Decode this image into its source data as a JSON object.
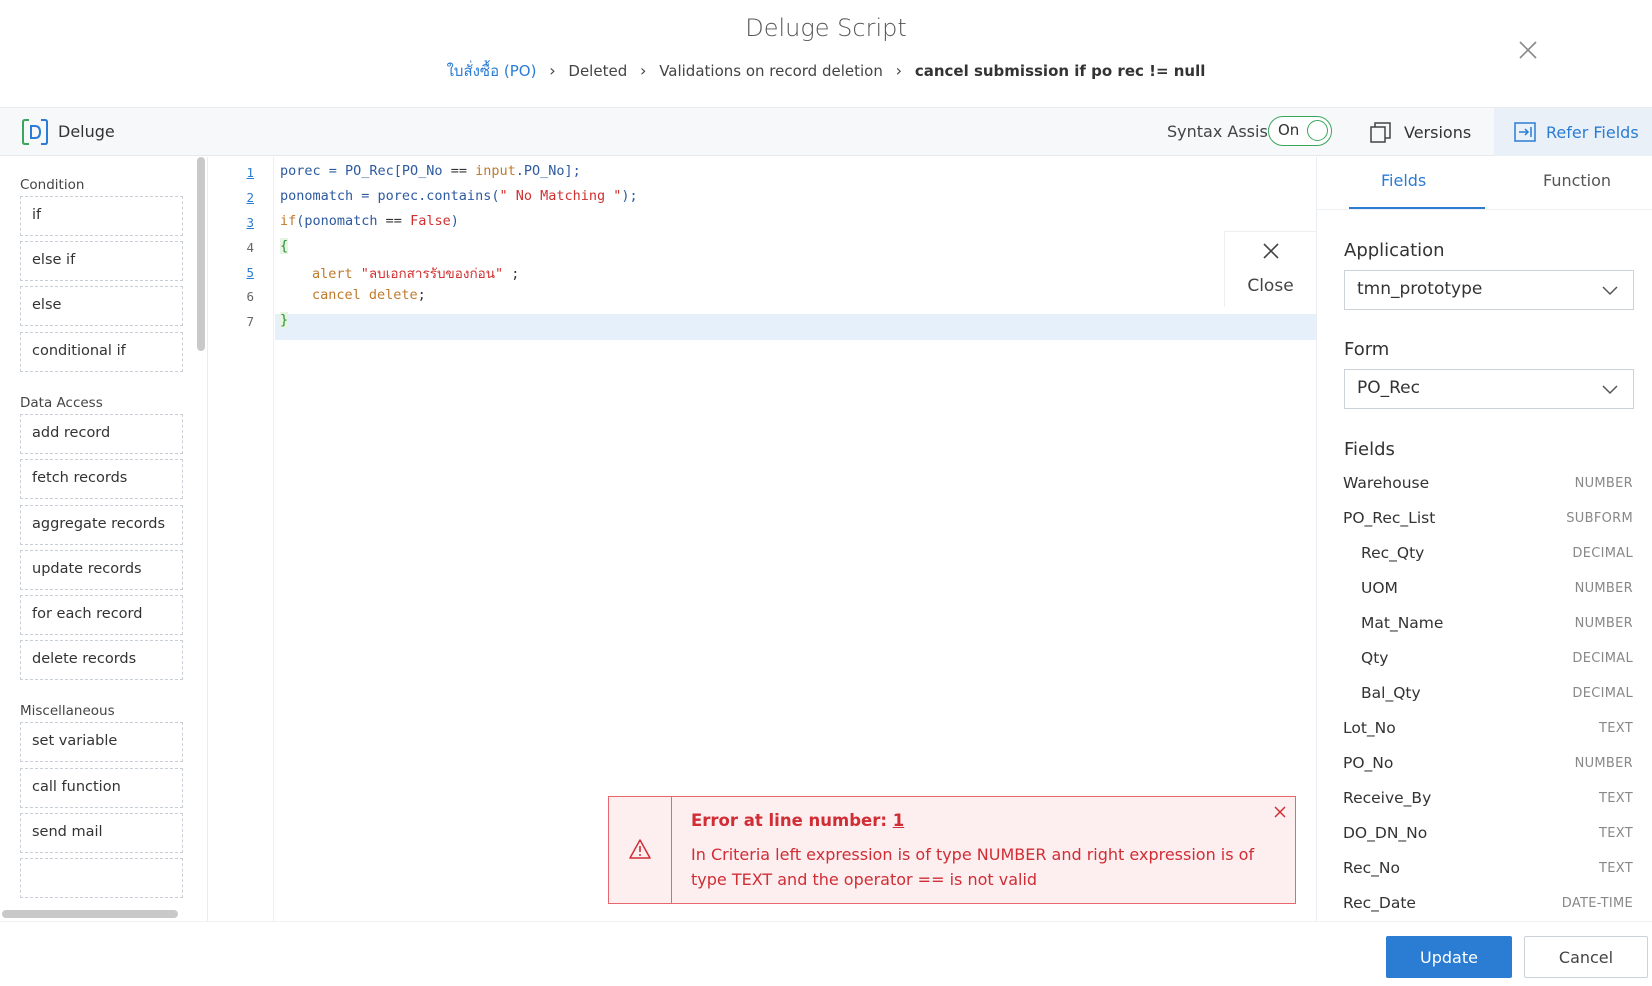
{
  "header": {
    "title": "Deluge Script",
    "breadcrumb": [
      "ใบสั่งซื้อ (PO)",
      "Deleted",
      "Validations on record deletion",
      "cancel submission if po rec != null"
    ]
  },
  "toolbar": {
    "brand": "Deluge",
    "syntax_assist_label": "Syntax Assist",
    "syntax_assist_state": "On",
    "versions_label": "Versions",
    "refer_fields_label": "Refer Fields"
  },
  "palette": {
    "sections": [
      {
        "title": "Condition",
        "items": [
          "if",
          "else if",
          "else",
          "conditional if"
        ]
      },
      {
        "title": "Data Access",
        "items": [
          "add record",
          "fetch records",
          "aggregate records",
          "update records",
          "for each record",
          "delete records"
        ]
      },
      {
        "title": "Miscellaneous",
        "items": [
          "set variable",
          "call function",
          "send mail"
        ]
      }
    ]
  },
  "editor": {
    "line_numbers": [
      "1",
      "2",
      "3",
      "4",
      "5",
      "6",
      "7"
    ],
    "code": {
      "l1": {
        "a": "porec = PO_Rec[PO_No ",
        "b": "==",
        "c": " ",
        "d": "input",
        "e": ".PO_No];"
      },
      "l2": {
        "a": "ponomatch = porec.contains(",
        "b": "\" No Matching \"",
        "c": ");"
      },
      "l3": {
        "a": "if",
        "b": "(ponomatch ",
        "c": "==",
        "d": " ",
        "e": "False",
        "f": ")"
      },
      "l4": {
        "a": "{"
      },
      "l5": {
        "a": "alert",
        "b": " ",
        "c": "\"ลบเอกสารรับของก่อน\"",
        "d": " ;"
      },
      "l6": {
        "a": "cancel delete",
        "b": ";"
      },
      "l7": {
        "a": "}"
      }
    },
    "close_label": "Close"
  },
  "error": {
    "title_prefix": "Error at line number: ",
    "line": "1",
    "message": "In Criteria left expression is of type NUMBER and right expression is of type TEXT and the operator == is not valid"
  },
  "refer_panel": {
    "tabs": [
      "Fields",
      "Function"
    ],
    "application_label": "Application",
    "application_value": "tmn_prototype",
    "form_label": "Form",
    "form_value": "PO_Rec",
    "fields_label": "Fields",
    "fields": [
      {
        "name": "Warehouse",
        "type": "NUMBER"
      },
      {
        "name": "PO_Rec_List",
        "type": "SUBFORM"
      },
      {
        "name": "Rec_Qty",
        "type": "DECIMAL"
      },
      {
        "name": "UOM",
        "type": "NUMBER"
      },
      {
        "name": "Mat_Name",
        "type": "NUMBER"
      },
      {
        "name": "Qty",
        "type": "DECIMAL"
      },
      {
        "name": "Bal_Qty",
        "type": "DECIMAL"
      },
      {
        "name": "Lot_No",
        "type": "TEXT"
      },
      {
        "name": "PO_No",
        "type": "NUMBER"
      },
      {
        "name": "Receive_By",
        "type": "TEXT"
      },
      {
        "name": "DO_DN_No",
        "type": "TEXT"
      },
      {
        "name": "Rec_No",
        "type": "TEXT"
      },
      {
        "name": "Rec_Date",
        "type": "DATE-TIME"
      }
    ]
  },
  "footer": {
    "update_label": "Update",
    "cancel_label": "Cancel"
  },
  "colors": {
    "accent": "#2b7cd3",
    "error": "#d02d35",
    "toggle": "#3aa65c"
  }
}
